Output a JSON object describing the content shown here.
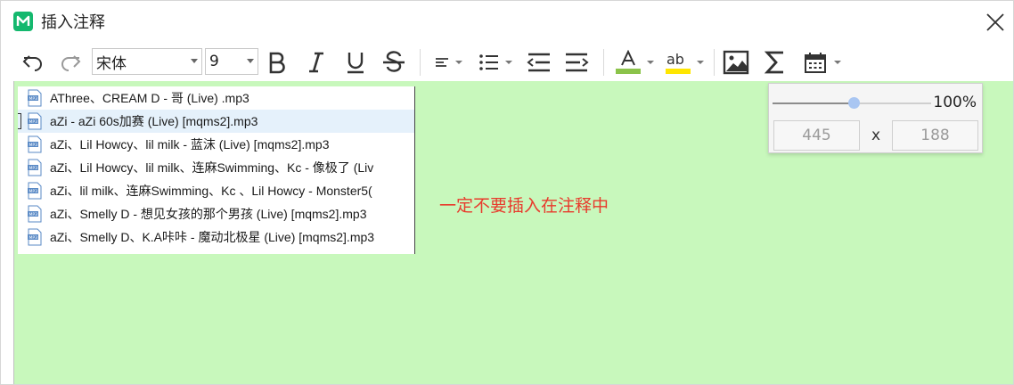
{
  "window": {
    "title": "插入注释"
  },
  "toolbar": {
    "font_name": "宋体",
    "font_size": "9",
    "underline_color": "#8bc34a",
    "highlight_color": "#ffe600"
  },
  "files": [
    {
      "name": "AThree、CREAM D - 哥 (Live) .mp3",
      "selected": false
    },
    {
      "name": "aZi - aZi 60s加赛 (Live) [mqms2].mp3",
      "selected": true
    },
    {
      "name": "aZi、Lil Howcy、lil milk - 蓝沫 (Live) [mqms2].mp3",
      "selected": false
    },
    {
      "name": "aZi、Lil Howcy、lil milk、连麻Swimming、Kc - 像极了 (Liv",
      "selected": false
    },
    {
      "name": "aZi、lil milk、连麻Swimming、Kc 、Lil Howcy - Monster5(",
      "selected": false
    },
    {
      "name": "aZi、Smelly D - 想见女孩的那个男孩 (Live) [mqms2].mp3",
      "selected": false
    },
    {
      "name": "aZi、Smelly D、K.A咔咔 - 魔动北极星 (Live) [mqms2].mp3",
      "selected": false
    }
  ],
  "note": "一定不要插入在注释中",
  "size_popup": {
    "zoom": "100%",
    "zoom_fraction": 0.5,
    "width": "445",
    "x_label": "x",
    "height": "188"
  },
  "colors": {
    "editor_bg": "#c8f8bc",
    "note_text": "#e83a2c"
  }
}
